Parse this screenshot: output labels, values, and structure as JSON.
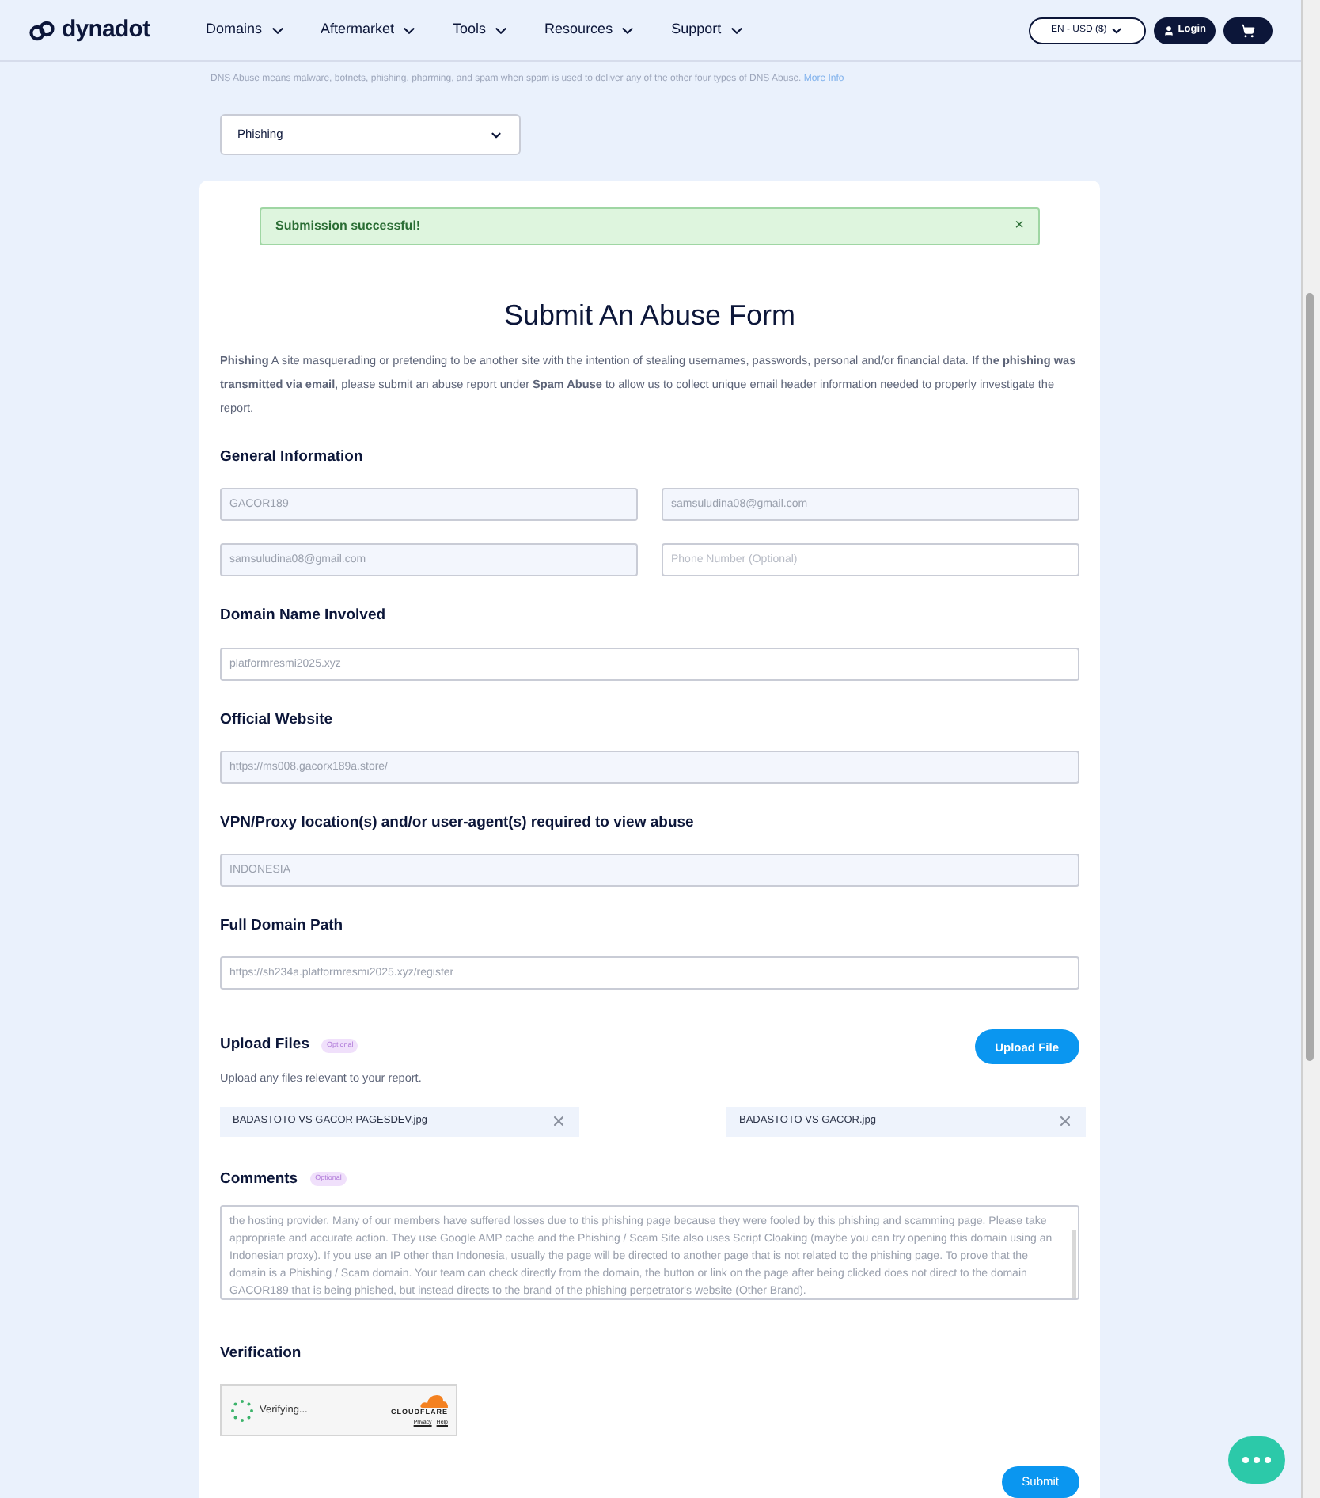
{
  "header": {
    "logo": "dynadot",
    "nav": [
      {
        "label": "Domains"
      },
      {
        "label": "Aftermarket"
      },
      {
        "label": "Tools"
      },
      {
        "label": "Resources"
      },
      {
        "label": "Support"
      }
    ],
    "currency": "EN - USD ($)",
    "login": "Login"
  },
  "notice": {
    "text": "DNS Abuse means malware, botnets, phishing, pharming, and spam when spam is used to deliver any of the other four types of DNS Abuse.",
    "link": "More Info"
  },
  "abuse_type": {
    "value": "Phishing"
  },
  "alert": {
    "text": "Submission successful!",
    "close": "×"
  },
  "form": {
    "title": "Submit An Abuse Form",
    "description": "**Phishing** A site masquerading or pretending to be another site with the intention of stealing usernames, passwords, personal and/or financial data. **If the phishing was transmitted via email**, please submit an abuse report under **Spam Abuse** to allow us to collect unique email header information needed to properly investigate the report.",
    "general": {
      "heading": "General Information",
      "fields": [
        {
          "value": "GACOR189",
          "autofilled": true
        },
        {
          "value": "samsuludina08@gmail.com",
          "autofilled": true
        },
        {
          "value": "samsuludina08@gmail.com",
          "autofilled": true
        },
        {
          "placeholder": "Phone Number (Optional)",
          "autofilled": false
        }
      ]
    },
    "sections": [
      {
        "heading": "Domain Name Involved",
        "field": {
          "value": "platformresmi2025.xyz",
          "autofilled": false
        }
      },
      {
        "heading": "Official Website",
        "field": {
          "value": "https://ms008.gacorx189a.store/",
          "autofilled": true
        }
      },
      {
        "heading": "VPN/Proxy location(s) and/or user-agent(s) required to view abuse",
        "field": {
          "value": "INDONESIA",
          "autofilled": true
        }
      },
      {
        "heading": "Full Domain Path",
        "field": {
          "value": "https://sh234a.platformresmi2025.xyz/register",
          "autofilled": false
        }
      }
    ],
    "upload": {
      "heading": "Upload Files",
      "badge": "Optional",
      "hint": "Upload any files relevant to your report.",
      "button": "Upload File",
      "files": [
        {
          "name": "BADASTOTO VS GACOR PAGESDEV.jpg"
        },
        {
          "name": "BADASTOTO VS GACOR.jpg"
        }
      ]
    },
    "comments": {
      "heading": "Comments",
      "badge": "Optional",
      "value": "the hosting provider. Many of our members have suffered losses due to this phishing page because they were fooled by this phishing and scamming page. Please take appropriate and accurate action. They use Google AMP cache and the Phishing / Scam Site also uses Script Cloaking (maybe you can try opening this domain using an Indonesian proxy). If you use an IP other than Indonesia, usually the page will be directed to another page that is not related to the phishing page. To prove that the domain is a Phishing / Scam domain. Your team can check directly from the domain, the button or link on the page after being clicked does not direct to the domain GACOR189 that is being phished, but instead directs to the brand of the phishing perpetrator's website (Other Brand)."
    },
    "verification": {
      "heading": "Verification",
      "status": "Verifying...",
      "brand": "CLOUDFLARE",
      "links": [
        "Privacy",
        "Help"
      ]
    },
    "submit": "Submit"
  }
}
